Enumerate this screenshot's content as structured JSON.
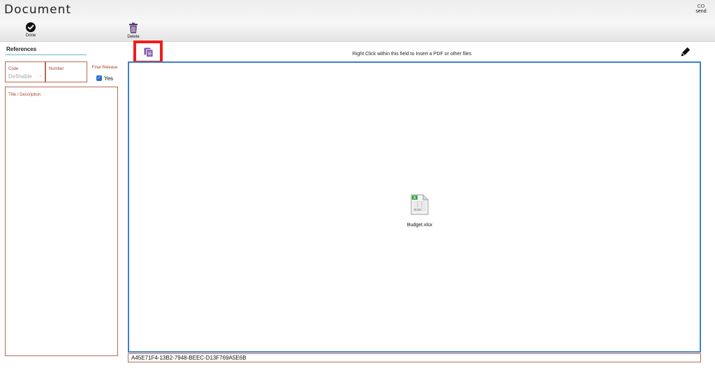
{
  "app": {
    "title": "Document"
  },
  "toolbar": {
    "done_label": "Done",
    "delete_label": "Delete",
    "send_label": "send",
    "send_icon_text": "CO"
  },
  "sidebar": {
    "header": "References",
    "code": {
      "label": "Code",
      "value": "Definable"
    },
    "number": {
      "label": "Number",
      "value": ""
    },
    "final_release": {
      "label": "Final Release",
      "checked": true,
      "option_label": "Yes"
    },
    "description": {
      "label": "Title / Description",
      "value": ""
    }
  },
  "main": {
    "instruction": "Right Click within this field to Insert a PDF or other files",
    "files": [
      {
        "name": "Budget.xlsx",
        "icon": "excel-file-icon",
        "badge": "XLSX"
      }
    ],
    "guid": "A45E71F4-13B2-7948-BEEC-D13F769A5E6B"
  },
  "colors": {
    "accent_blue": "#3f7fc8",
    "label_red": "#a8472a",
    "field_border": "#b86a52",
    "highlight_red": "#f01c1c",
    "delete_purple": "#5b3a73",
    "copy_purple": "#7a4fa8"
  }
}
